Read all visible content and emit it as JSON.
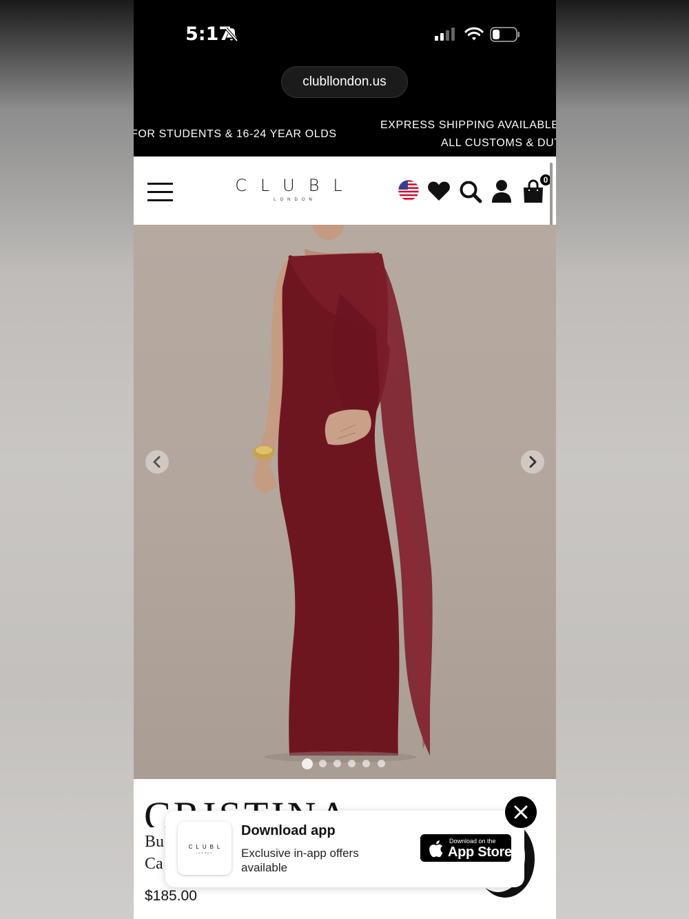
{
  "status_bar": {
    "time": "5:17"
  },
  "browser": {
    "url": "clubllondon.us"
  },
  "promo": {
    "left_text": "FOR STUDENTS & 16-24 YEAR OLDS",
    "right_line1": "EXPRESS SHIPPING AVAILABLE",
    "right_line2": "ALL CUSTOMS & DUT"
  },
  "header": {
    "logo_main": "CLUBL",
    "logo_sub": "LONDON",
    "cart_count": "0"
  },
  "gallery": {
    "image_count": 6,
    "active_index": 0
  },
  "product": {
    "title": "CRISTINA",
    "subtitle_line1": "Bu",
    "subtitle_line2": "Ca",
    "price": "$185.00"
  },
  "app_banner": {
    "logo_main": "CLUBL",
    "logo_sub": "LONDON",
    "title": "Download app",
    "description": "Exclusive in-app offers available",
    "store_small": "Download on the",
    "store_big": "App Store"
  },
  "colors": {
    "dress": "#6e1620",
    "backdrop": "#b2a69d"
  }
}
